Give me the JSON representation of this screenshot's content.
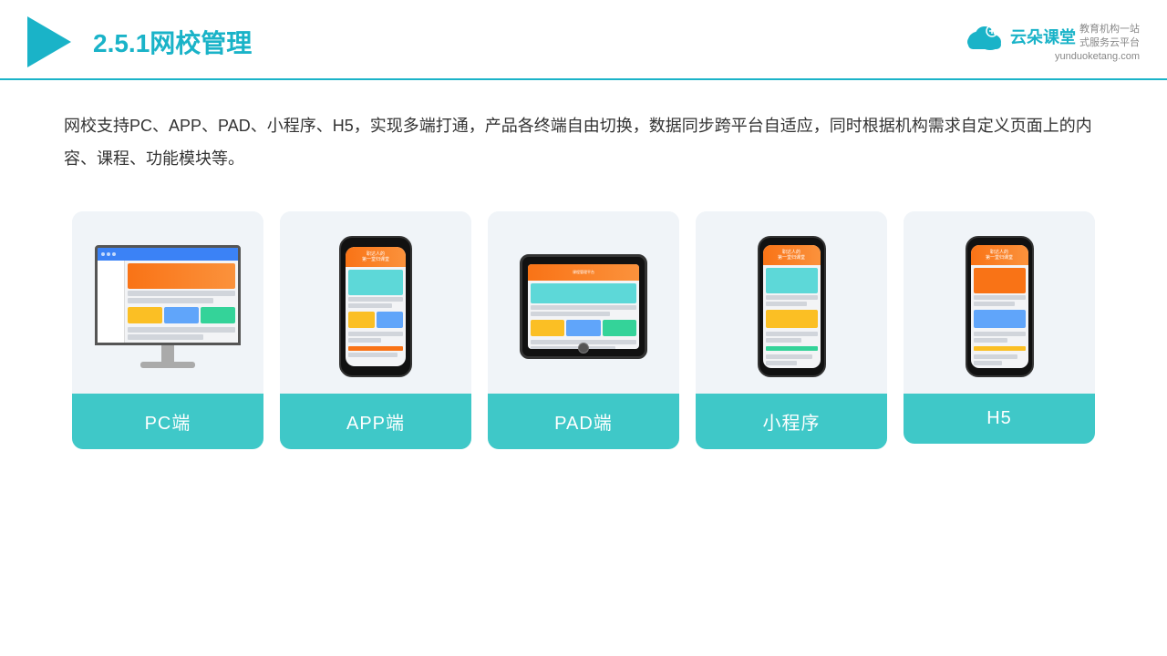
{
  "header": {
    "section_number": "2.5.1",
    "title_prefix": "2.5.1",
    "title_main": "网校管理",
    "logo_name": "云朵课堂",
    "logo_url": "yunduoketang.com",
    "logo_tagline_line1": "教育机构一站",
    "logo_tagline_line2": "式服务云平台"
  },
  "description": {
    "text": "网校支持PC、APP、PAD、小程序、H5，实现多端打通，产品各终端自由切换，数据同步跨平台自适应，同时根据机构需求自定义页面上的内容、课程、功能模块等。"
  },
  "cards": [
    {
      "id": "pc",
      "label": "PC端"
    },
    {
      "id": "app",
      "label": "APP端"
    },
    {
      "id": "pad",
      "label": "PAD端"
    },
    {
      "id": "miniprogram",
      "label": "小程序"
    },
    {
      "id": "h5",
      "label": "H5"
    }
  ]
}
